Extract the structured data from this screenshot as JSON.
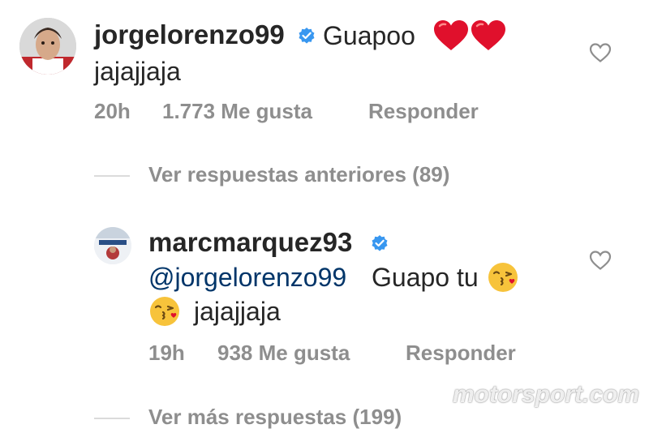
{
  "comment1": {
    "username": "jorgelorenzo99",
    "text_inline": "Guapoo",
    "text_line2": "jajajjaja",
    "time": "20h",
    "likes": "1.773 Me gusta",
    "reply": "Responder"
  },
  "prev_replies": "Ver respuestas anteriores (89)",
  "comment2": {
    "username": "marcmarquez93",
    "mention": "@jorgelorenzo99",
    "text_after_mention": "Guapo tu",
    "text_line2": "jajajjaja",
    "time": "19h",
    "likes": "938 Me gusta",
    "reply": "Responder"
  },
  "more_replies": "Ver más respuestas (199)",
  "watermark": "motorsport.com",
  "colors": {
    "text": "#262626",
    "meta": "#8e8e8e",
    "mention": "#003569",
    "verified": "#3897f0",
    "heart_emoji": "#e0102c"
  }
}
